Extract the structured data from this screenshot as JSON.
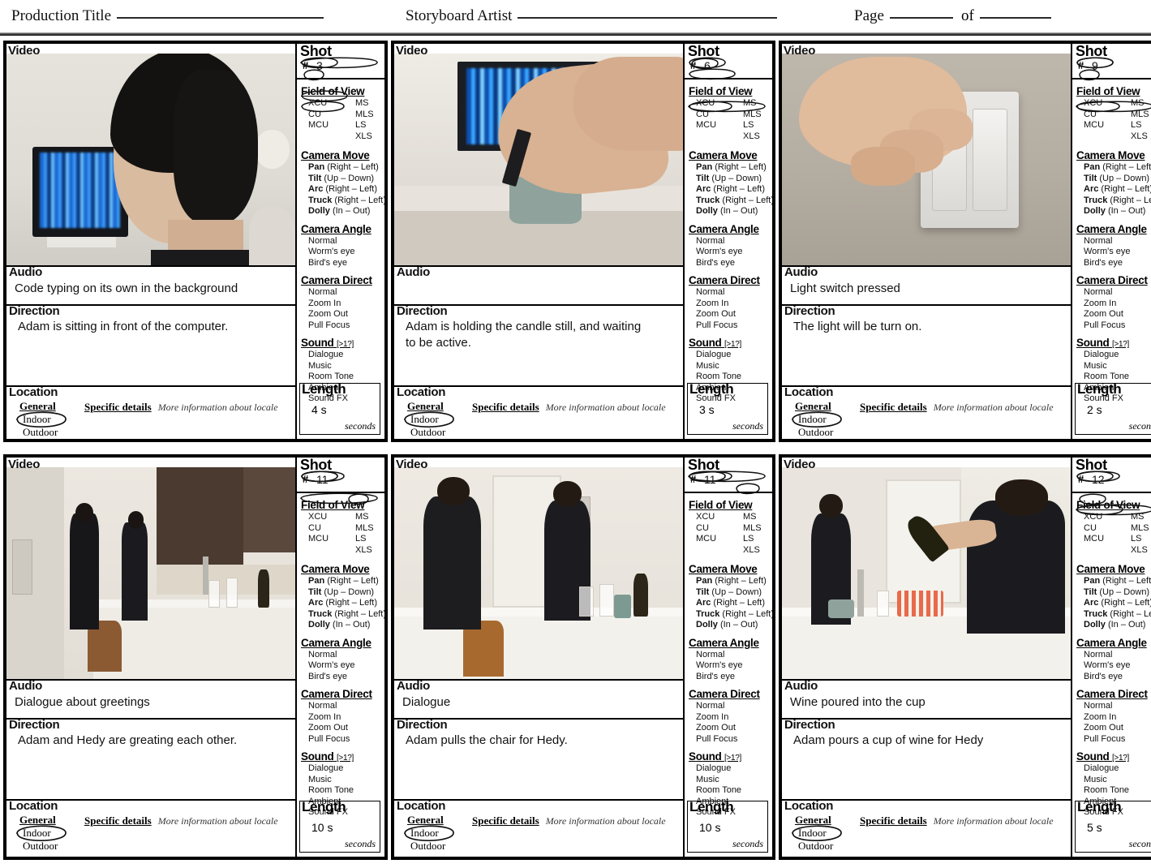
{
  "header": {
    "production_title_label": "Production Title",
    "storyboard_artist_label": "Storyboard Artist",
    "page_label": "Page",
    "of_label": "of"
  },
  "labels": {
    "video": "Video",
    "audio": "Audio",
    "direction": "Direction",
    "location": "Location",
    "shot": "Shot",
    "hash": "#",
    "field_of_view": "Field of View",
    "camera_move": "Camera Move",
    "camera_angle": "Camera Angle",
    "camera_direct": "Camera Direct",
    "sound": "Sound",
    "sound_hint": "[>1?]",
    "length": "Length",
    "seconds": "seconds",
    "seconds_clipped": "secon",
    "general": "General",
    "specific_details": "Specific details",
    "specific_hint": "More information about locale"
  },
  "options": {
    "fov_left": [
      "XCU",
      "CU",
      "MCU"
    ],
    "fov_right": [
      "MS",
      "MLS",
      "LS",
      "XLS"
    ],
    "camera_move": [
      {
        "bold": "Pan",
        "rest": "(Right – Left)"
      },
      {
        "bold": "Tilt",
        "rest": "(Up – Down)"
      },
      {
        "bold": "Arc",
        "rest": "(Right – Left)"
      },
      {
        "bold": "Truck",
        "rest": "(Right – Left)"
      },
      {
        "bold": "Dolly",
        "rest": "(In – Out)"
      }
    ],
    "camera_angle": [
      "Normal",
      "Worm's eye",
      "Bird's eye"
    ],
    "camera_direct": [
      "Normal",
      "Zoom In",
      "Zoom Out",
      "Pull Focus"
    ],
    "sound": [
      "Dialogue",
      "Music",
      "Room Tone",
      "Ambient",
      "Sound FX"
    ],
    "location_general": [
      "Indoor",
      "Outdoor"
    ]
  },
  "panels": [
    {
      "shot_number": "3",
      "scene": "s1",
      "audio": "Code typing on its own in the background",
      "direction": "Adam is sitting in front of the computer.",
      "length_value": "4 s",
      "selected": {
        "fov": "CU",
        "camera_move": "Pan",
        "camera_angle": "Normal",
        "camera_direct": "Pull Focus",
        "sound": "Sound FX",
        "location": "Indoor"
      }
    },
    {
      "shot_number": "6",
      "scene": "s2",
      "audio": "",
      "direction": "Adam is holding the candle still, and waiting\nto be active.",
      "length_value": "3 s",
      "selected": {
        "fov": "XCU",
        "camera_move": "Dolly",
        "camera_angle": "Normal",
        "camera_direct": "Zoom In",
        "sound": "Sound FX",
        "location": "Indoor"
      }
    },
    {
      "shot_number": "9",
      "scene": "s3",
      "audio": "Light switch pressed",
      "direction": "The light will be turn on.",
      "length_value": "2 s",
      "selected": {
        "fov": "CU",
        "camera_move": "Dolly",
        "camera_angle": "Normal",
        "camera_direct": "Normal",
        "sound": "Sound FX",
        "location": "Indoor"
      }
    },
    {
      "shot_number": "11",
      "scene": "s4",
      "audio": "Dialogue about greetings",
      "direction": "Adam and Hedy are greating each other.",
      "length_value": "10  s",
      "selected": {
        "fov": "LS",
        "camera_move": "Arc",
        "camera_angle": "Normal",
        "camera_direct": "Normal",
        "sound": "Dialogue",
        "location": "Indoor"
      }
    },
    {
      "shot_number": "11",
      "scene": "s5",
      "audio": "Dialogue",
      "direction": "Adam pulls the chair for Hedy.",
      "length_value": "10  s",
      "selected": {
        "fov": "MLS",
        "camera_move": "Pan",
        "camera_angle": "Normal",
        "camera_direct": "Normal",
        "sound": "Dialogue",
        "location": "Indoor"
      }
    },
    {
      "shot_number": "12",
      "scene": "s6",
      "audio": "Wine poured into the cup",
      "direction": "Adam pours a cup of wine for Hedy",
      "length_value": "5 s",
      "selected": {
        "fov": "MCU",
        "camera_move": "Truck",
        "camera_angle": "Normal",
        "camera_direct": "Pull Focus",
        "sound": "Dialogue",
        "location": "Indoor"
      }
    }
  ]
}
